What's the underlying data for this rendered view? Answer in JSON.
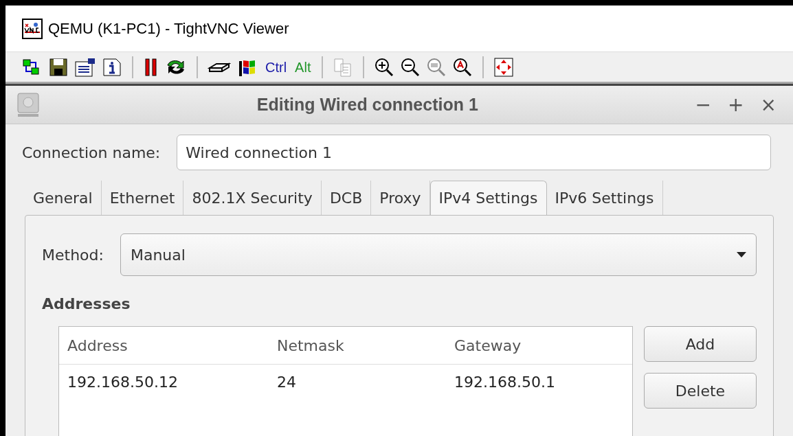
{
  "window": {
    "title": "QEMU (K1-PC1) - TightVNC Viewer"
  },
  "toolbar": {
    "keys": [
      {
        "label": "Ctrl",
        "kind": "ctrl"
      },
      {
        "label": "Alt",
        "kind": "alt"
      }
    ]
  },
  "dialog": {
    "title": "Editing Wired connection 1",
    "controls": [
      "−",
      "+",
      "×"
    ],
    "connection_name": {
      "label": "Connection name:",
      "value": "Wired connection 1"
    },
    "tabs": [
      {
        "label": "General",
        "selected": false
      },
      {
        "label": "Ethernet",
        "selected": false
      },
      {
        "label": "802.1X Security",
        "selected": false
      },
      {
        "label": "DCB",
        "selected": false
      },
      {
        "label": "Proxy",
        "selected": false
      },
      {
        "label": "IPv4 Settings",
        "selected": true
      },
      {
        "label": "IPv6 Settings",
        "selected": false
      }
    ],
    "method": {
      "label": "Method:",
      "value": "Manual"
    },
    "addresses": {
      "heading": "Addresses",
      "columns": [
        "Address",
        "Netmask",
        "Gateway"
      ],
      "rows": [
        [
          "192.168.50.12",
          "24",
          "192.168.50.1"
        ]
      ],
      "buttons": [
        "Add",
        "Delete"
      ]
    }
  }
}
